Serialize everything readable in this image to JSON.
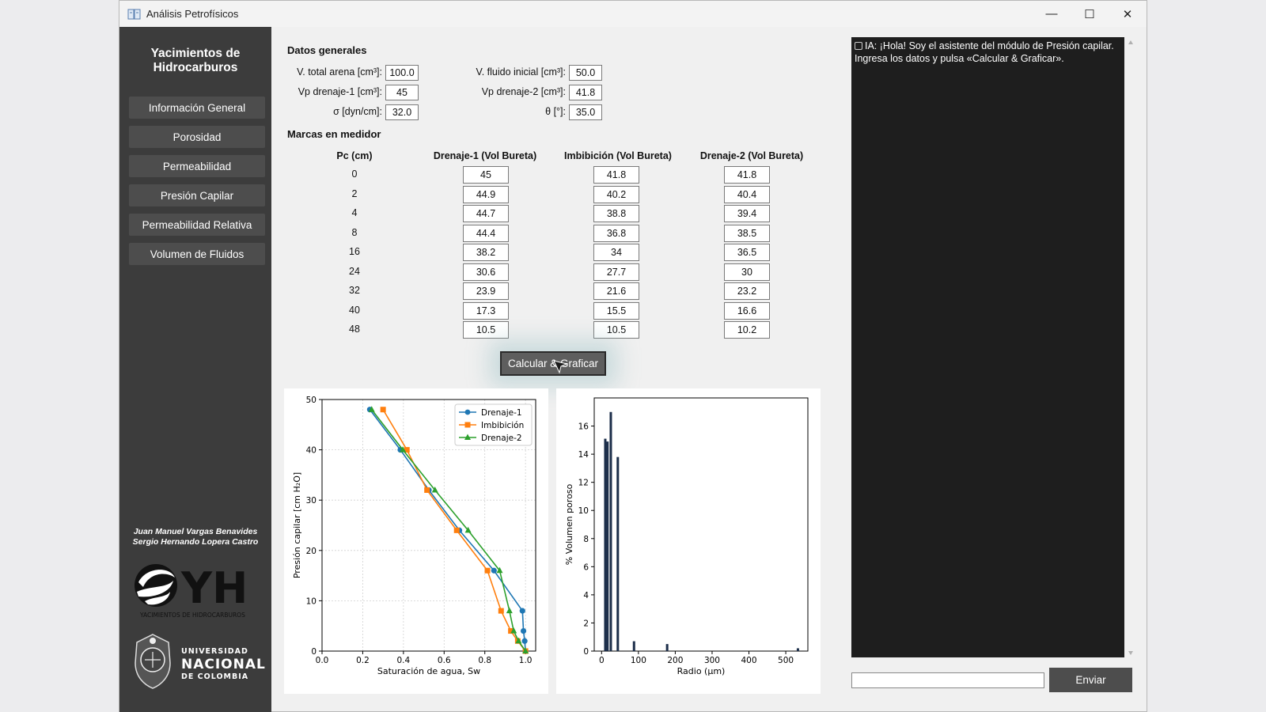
{
  "window": {
    "title": "Análisis Petrofísicos"
  },
  "sidebar": {
    "title_line1": "Yacimientos de",
    "title_line2": "Hidrocarburos",
    "items": [
      {
        "label": "Información General"
      },
      {
        "label": "Porosidad"
      },
      {
        "label": "Permeabilidad"
      },
      {
        "label": "Presión Capilar"
      },
      {
        "label": "Permeabilidad Relativa"
      },
      {
        "label": "Volumen de Fluidos"
      }
    ],
    "author1": "Juan Manuel Vargas Benavides",
    "author2": "Sergio Hernando Lopera Castro",
    "logo_yh_text": "YH",
    "logo_yh_caption": "YACIMIENTOS DE HIDROCARBUROS",
    "logo_un_line1": "UNIVERSIDAD",
    "logo_un_line2": "NACIONAL",
    "logo_un_line3": "DE COLOMBIA"
  },
  "general": {
    "title": "Datos generales",
    "fields": [
      {
        "label": "V. total arena [cm³]:",
        "value": "100.0"
      },
      {
        "label": "Vp drenaje-1 [cm³]:",
        "value": "45"
      },
      {
        "label": "σ [dyn/cm]:",
        "value": "32.0"
      },
      {
        "label": "V. fluido inicial [cm³]:",
        "value": "50.0"
      },
      {
        "label": "Vp drenaje-2 [cm³]:",
        "value": "41.8"
      },
      {
        "label": "θ [°]:",
        "value": "35.0"
      }
    ]
  },
  "marks": {
    "title": "Marcas en medidor",
    "headers": [
      "Pc (cm)",
      "Drenaje-1 (Vol Bureta)",
      "Imbibición (Vol Bureta)",
      "Drenaje-2 (Vol Bureta)"
    ],
    "rows": [
      {
        "pc": "0",
        "d1": "45",
        "im": "41.8",
        "d2": "41.8"
      },
      {
        "pc": "2",
        "d1": "44.9",
        "im": "40.2",
        "d2": "40.4"
      },
      {
        "pc": "4",
        "d1": "44.7",
        "im": "38.8",
        "d2": "39.4"
      },
      {
        "pc": "8",
        "d1": "44.4",
        "im": "36.8",
        "d2": "38.5"
      },
      {
        "pc": "16",
        "d1": "38.2",
        "im": "34",
        "d2": "36.5"
      },
      {
        "pc": "24",
        "d1": "30.6",
        "im": "27.7",
        "d2": "30"
      },
      {
        "pc": "32",
        "d1": "23.9",
        "im": "21.6",
        "d2": "23.2"
      },
      {
        "pc": "40",
        "d1": "17.3",
        "im": "15.5",
        "d2": "16.6"
      },
      {
        "pc": "48",
        "d1": "10.5",
        "im": "10.5",
        "d2": "10.2"
      }
    ]
  },
  "calc_button_label": "Calcular & Graficar",
  "chat": {
    "message": "IA: ¡Hola! Soy el asistente del módulo de Presión capilar. Ingresa los datos y pulsa «Calcular & Graficar».",
    "input_value": "",
    "send_label": "Enviar"
  },
  "colors": {
    "d1": "#1f77b4",
    "im": "#ff7f0e",
    "d2": "#2ca02c",
    "bar": "#1c2e4a"
  },
  "chart_data": [
    {
      "type": "line",
      "xlabel": "Saturación de agua, Sw",
      "ylabel": "Presión capilar [cm H₂O]",
      "xlim": [
        0,
        1.05
      ],
      "ylim": [
        0,
        50
      ],
      "xticks": [
        "0.0",
        "0.2",
        "0.4",
        "0.6",
        "0.8",
        "1.0"
      ],
      "yticks": [
        "0",
        "10",
        "20",
        "30",
        "40",
        "50"
      ],
      "grid": true,
      "legend": "top-right",
      "series": [
        {
          "name": "Drenaje-1",
          "marker": "circle",
          "x": [
            1.0,
            0.996,
            0.99,
            0.985,
            0.845,
            0.675,
            0.525,
            0.385,
            0.235
          ],
          "y": [
            0,
            2,
            4,
            8,
            16,
            24,
            32,
            40,
            48
          ]
        },
        {
          "name": "Imbibición",
          "marker": "square",
          "x": [
            1.0,
            0.962,
            0.928,
            0.88,
            0.813,
            0.662,
            0.516,
            0.417,
            0.3
          ],
          "y": [
            0,
            2,
            4,
            8,
            16,
            24,
            32,
            40,
            48
          ]
        },
        {
          "name": "Drenaje-2",
          "marker": "triangle",
          "x": [
            1.0,
            0.966,
            0.942,
            0.921,
            0.873,
            0.718,
            0.555,
            0.397,
            0.244
          ],
          "y": [
            0,
            2,
            4,
            8,
            16,
            24,
            32,
            40,
            48
          ]
        }
      ]
    },
    {
      "type": "bar",
      "xlabel": "Radio (µm)",
      "ylabel": "% Volumen poroso",
      "xlim": [
        -20,
        560
      ],
      "ylim": [
        0,
        18
      ],
      "xticks": [
        0,
        100,
        200,
        300,
        400,
        500
      ],
      "yticks": [
        0,
        2,
        4,
        6,
        8,
        10,
        12,
        14,
        16
      ],
      "bars": [
        {
          "x": 10,
          "value": 15.1
        },
        {
          "x": 16,
          "value": 14.9
        },
        {
          "x": 25,
          "value": 17.0
        },
        {
          "x": 44,
          "value": 13.8
        },
        {
          "x": 88,
          "value": 0.7
        },
        {
          "x": 178,
          "value": 0.5
        },
        {
          "x": 533,
          "value": 0.2
        }
      ]
    }
  ]
}
